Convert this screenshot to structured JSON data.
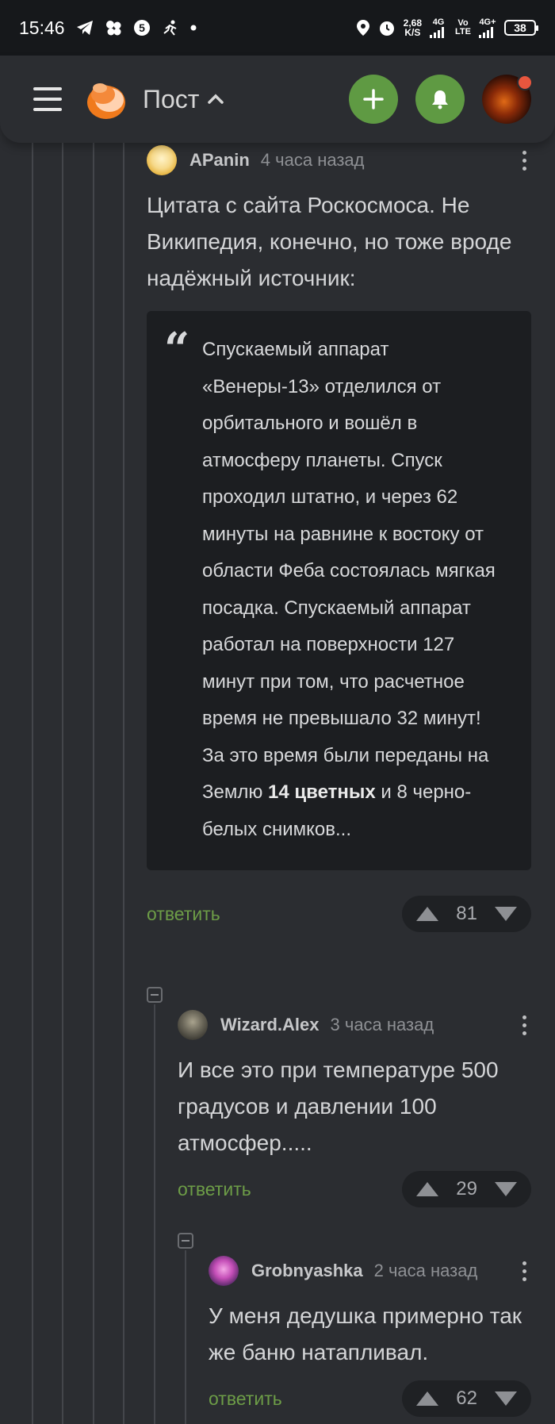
{
  "status_bar": {
    "time": "15:46",
    "net_speed_value": "2,68",
    "net_speed_unit": "K/S",
    "network_1": "4G",
    "network_2_top": "Vo",
    "network_2_bottom": "LTE",
    "network_3": "4G+",
    "battery": "38"
  },
  "header": {
    "title": "Пост"
  },
  "comments": [
    {
      "author": "APanin",
      "time": "4 часа назад",
      "text": "Цитата с сайта Роскосмоса. Не Википедия, конечно, но тоже вроде надёжный источник:",
      "quote_before": "Спускаемый аппарат «Венеры-13» отделился от орбитального и вошёл в атмосферу планеты. Спуск проходил штатно, и через 62 минуты на равнине к востоку от области Феба состоялась мягкая посадка. Спускаемый аппарат работал на поверхности 127 минут при том, что расчетное время не превышало 32 минут! За это время были переданы на Землю ",
      "quote_bold": "14 цветных",
      "quote_after": " и 8 черно-белых снимков...",
      "reply_label": "ответить",
      "score": "81"
    },
    {
      "author": "Wizard.Alex",
      "time": "3 часа назад",
      "text": "И все это при температуре 500 градусов и давлении 100 атмосфер.....",
      "reply_label": "ответить",
      "score": "29"
    },
    {
      "author": "Grobnyashka",
      "time": "2 часа назад",
      "text": "У меня дедушка примерно так же баню натапливал.",
      "reply_label": "ответить",
      "score": "62"
    }
  ],
  "colors": {
    "accent_green": "#5f9a43",
    "reply_green": "#6d9d47",
    "background": "#2b2d31",
    "quote_bg": "#1c1e21"
  }
}
